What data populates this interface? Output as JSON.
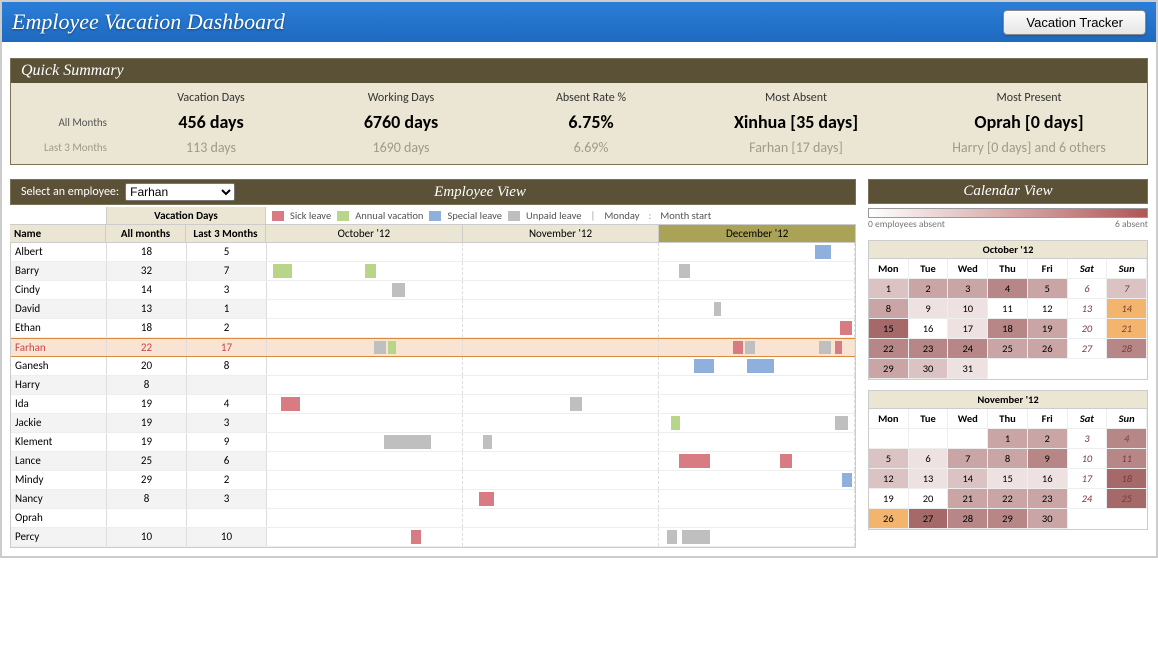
{
  "header": {
    "title": "Employee Vacation Dashboard",
    "button": "Vacation Tracker"
  },
  "summary": {
    "title": "Quick Summary",
    "cols": [
      "Vacation Days",
      "Working Days",
      "Absent Rate %",
      "Most Absent",
      "Most Present"
    ],
    "rows": {
      "all_label": "All Months",
      "l3_label": "Last 3 Months",
      "all": [
        "456 days",
        "6760 days",
        "6.75%",
        "Xinhua [35 days]",
        "Oprah [0 days]"
      ],
      "l3": [
        "113 days",
        "1690 days",
        "6.69%",
        "Farhan [17 days]",
        "Harry [0 days] and 6 others"
      ]
    }
  },
  "empview": {
    "title": "Employee View",
    "select_label": "Select an employee:",
    "selected": "Farhan",
    "legend": {
      "sick": "Sick leave",
      "annual": "Annual vacation",
      "special": "Special leave",
      "unpaid": "Unpaid leave",
      "monday": "Monday",
      "mstart": "Month start"
    },
    "table_head": {
      "vac": "Vacation Days",
      "name": "Name",
      "all": "All months",
      "l3": "Last 3 Months"
    },
    "months": [
      "October '12",
      "November '12",
      "December '12"
    ],
    "employees": [
      {
        "name": "Albert",
        "all": "18",
        "l3": "5",
        "bars": [
          {
            "m": 2,
            "l": 80,
            "w": 8,
            "c": "c-special"
          }
        ]
      },
      {
        "name": "Barry",
        "all": "32",
        "l3": "7",
        "bars": [
          {
            "m": 0,
            "l": 3,
            "w": 10,
            "c": "c-annual"
          },
          {
            "m": 0,
            "l": 50,
            "w": 6,
            "c": "c-annual"
          },
          {
            "m": 2,
            "l": 10,
            "w": 6,
            "c": "c-unpaid"
          }
        ]
      },
      {
        "name": "Cindy",
        "all": "14",
        "l3": "3",
        "bars": [
          {
            "m": 0,
            "l": 64,
            "w": 7,
            "c": "c-unpaid"
          }
        ]
      },
      {
        "name": "David",
        "all": "13",
        "l3": "1",
        "bars": [
          {
            "m": 2,
            "l": 28,
            "w": 4,
            "c": "c-unpaid"
          }
        ]
      },
      {
        "name": "Ethan",
        "all": "18",
        "l3": "2",
        "bars": [
          {
            "m": 2,
            "l": 93,
            "w": 6,
            "c": "c-sick"
          }
        ]
      },
      {
        "name": "Farhan",
        "all": "22",
        "l3": "17",
        "hi": true,
        "bars": [
          {
            "m": 0,
            "l": 55,
            "w": 6,
            "c": "c-unpaid"
          },
          {
            "m": 0,
            "l": 62,
            "w": 4,
            "c": "c-annual"
          },
          {
            "m": 2,
            "l": 38,
            "w": 5,
            "c": "c-sick"
          },
          {
            "m": 2,
            "l": 44,
            "w": 5,
            "c": "c-unpaid"
          },
          {
            "m": 2,
            "l": 82,
            "w": 6,
            "c": "c-unpaid"
          },
          {
            "m": 2,
            "l": 90,
            "w": 4,
            "c": "c-sick"
          }
        ]
      },
      {
        "name": "Ganesh",
        "all": "20",
        "l3": "8",
        "bars": [
          {
            "m": 2,
            "l": 18,
            "w": 10,
            "c": "c-special"
          },
          {
            "m": 2,
            "l": 45,
            "w": 14,
            "c": "c-special"
          }
        ]
      },
      {
        "name": "Harry",
        "all": "8",
        "l3": "",
        "bars": []
      },
      {
        "name": "Ida",
        "all": "19",
        "l3": "4",
        "bars": [
          {
            "m": 0,
            "l": 7,
            "w": 10,
            "c": "c-sick"
          },
          {
            "m": 1,
            "l": 55,
            "w": 6,
            "c": "c-unpaid"
          }
        ]
      },
      {
        "name": "Jackie",
        "all": "19",
        "l3": "3",
        "bars": [
          {
            "m": 2,
            "l": 6,
            "w": 5,
            "c": "c-annual"
          },
          {
            "m": 2,
            "l": 90,
            "w": 7,
            "c": "c-unpaid"
          }
        ]
      },
      {
        "name": "Klement",
        "all": "19",
        "l3": "9",
        "bars": [
          {
            "m": 0,
            "l": 60,
            "w": 24,
            "c": "c-unpaid"
          },
          {
            "m": 1,
            "l": 10,
            "w": 5,
            "c": "c-unpaid"
          }
        ]
      },
      {
        "name": "Lance",
        "all": "25",
        "l3": "6",
        "bars": [
          {
            "m": 2,
            "l": 10,
            "w": 16,
            "c": "c-sick"
          },
          {
            "m": 2,
            "l": 62,
            "w": 6,
            "c": "c-sick"
          }
        ]
      },
      {
        "name": "Mindy",
        "all": "29",
        "l3": "2",
        "bars": [
          {
            "m": 2,
            "l": 94,
            "w": 5,
            "c": "c-special"
          }
        ]
      },
      {
        "name": "Nancy",
        "all": "8",
        "l3": "3",
        "bars": [
          {
            "m": 1,
            "l": 8,
            "w": 8,
            "c": "c-sick"
          }
        ]
      },
      {
        "name": "Oprah",
        "all": "",
        "l3": "",
        "bars": []
      },
      {
        "name": "Percy",
        "all": "10",
        "l3": "10",
        "bars": [
          {
            "m": 0,
            "l": 74,
            "w": 5,
            "c": "c-sick"
          },
          {
            "m": 2,
            "l": 4,
            "w": 5,
            "c": "c-unpaid"
          },
          {
            "m": 2,
            "l": 12,
            "w": 14,
            "c": "c-unpaid"
          }
        ]
      }
    ]
  },
  "calview": {
    "title": "Calendar View",
    "legend_lo": "0 employees absent",
    "legend_hi": "6 absent",
    "dow": [
      "Mon",
      "Tue",
      "Wed",
      "Thu",
      "Fri",
      "Sat",
      "Sun"
    ],
    "cals": [
      {
        "title": "October '12",
        "offset": 0,
        "days": 31,
        "heat": {
          "1": 2,
          "2": 3,
          "3": 3,
          "4": 4,
          "5": 3,
          "7": 2,
          "8": 3,
          "9": 1,
          "10": 1,
          "14": 6,
          "15": 5,
          "17": 1,
          "18": 4,
          "19": 3,
          "21": 6,
          "22": 4,
          "23": 4,
          "24": 4,
          "25": 3,
          "26": 3,
          "28": 4,
          "29": 3,
          "30": 2,
          "31": 1
        }
      },
      {
        "title": "November '12",
        "offset": 3,
        "days": 30,
        "heat": {
          "1": 3,
          "2": 3,
          "4": 4,
          "5": 2,
          "6": 1,
          "7": 3,
          "8": 3,
          "9": 4,
          "11": 4,
          "12": 2,
          "13": 1,
          "14": 2,
          "15": 1,
          "16": 1,
          "18": 5,
          "21": 3,
          "22": 3,
          "23": 3,
          "25": 5,
          "26": 6,
          "27": 5,
          "28": 4,
          "29": 4,
          "30": 3
        }
      }
    ]
  }
}
